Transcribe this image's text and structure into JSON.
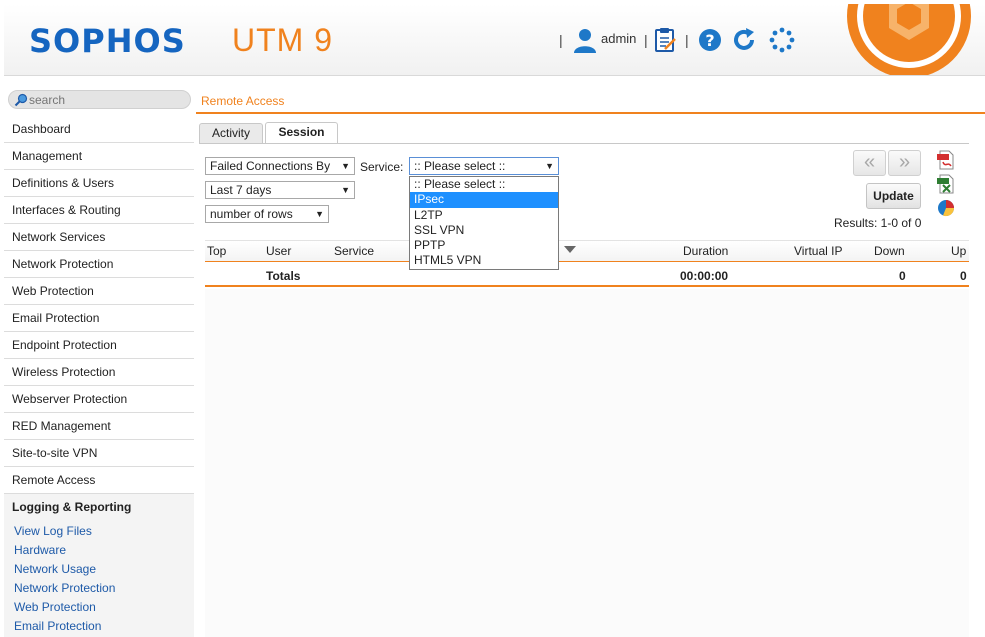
{
  "header": {
    "logo": "SOPHOS",
    "product": "UTM 9",
    "separator": "|",
    "user": "admin",
    "colors": {
      "brand": "#1565c0",
      "accent": "#f0821e"
    }
  },
  "search": {
    "placeholder": "search"
  },
  "sidebar": {
    "items": [
      "Dashboard",
      "Management",
      "Definitions & Users",
      "Interfaces & Routing",
      "Network Services",
      "Network Protection",
      "Web Protection",
      "Email Protection",
      "Endpoint Protection",
      "Wireless Protection",
      "Webserver Protection",
      "RED Management",
      "Site-to-site VPN",
      "Remote Access"
    ],
    "active": "Logging & Reporting",
    "subitems": [
      "View Log Files",
      "Hardware",
      "Network Usage",
      "Network Protection",
      "Web Protection",
      "Email Protection"
    ]
  },
  "breadcrumb": "Remote Access",
  "tabs": [
    {
      "label": "Activity",
      "active": false
    },
    {
      "label": "Session",
      "active": true
    }
  ],
  "filters": {
    "report_type": "Failed Connections By",
    "service_label": "Service:",
    "service_value": ":: Please select ::",
    "period": "Last 7 days",
    "rows": "number of rows",
    "arrow": "▼"
  },
  "service_dropdown": {
    "options": [
      ":: Please select ::",
      "IPsec",
      "L2TP",
      "SSL VPN",
      "PPTP",
      "HTML5 VPN"
    ],
    "highlighted": "IPsec"
  },
  "controls": {
    "prev": "«",
    "next": "»",
    "update": "Update",
    "results": "Results: 1-0 of 0"
  },
  "table": {
    "headers": [
      "Top",
      "User",
      "Service",
      "Duration",
      "Virtual IP",
      "Down",
      "Up"
    ],
    "totals": {
      "label": "Totals",
      "duration": "00:00:00",
      "down": "0",
      "up": "0"
    }
  }
}
